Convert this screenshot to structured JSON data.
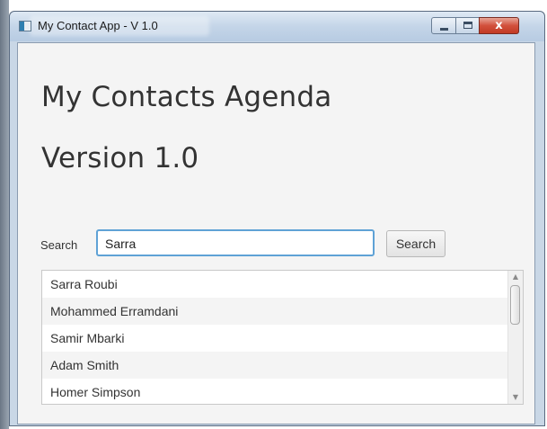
{
  "window": {
    "title": "My Contact App - V 1.0",
    "icons": {
      "app": "app-window-icon",
      "minimize": "minimize-icon",
      "maximize": "maximize-icon",
      "close": "close-icon"
    },
    "close_glyph": "x"
  },
  "main": {
    "heading_line1": "My Contacts Agenda",
    "heading_line2": "Version 1.0"
  },
  "search": {
    "label": "Search",
    "value": "Sarra",
    "button_label": "Search"
  },
  "contacts": {
    "items": [
      {
        "name": "Sarra Roubi"
      },
      {
        "name": "Mohammed Erramdani"
      },
      {
        "name": "Samir Mbarki"
      },
      {
        "name": "Adam Smith"
      },
      {
        "name": "Homer Simpson"
      }
    ]
  },
  "colors": {
    "accent_focus": "#5fa2d6",
    "titlebar": "#c4d5e8",
    "close_button": "#c23a24"
  }
}
